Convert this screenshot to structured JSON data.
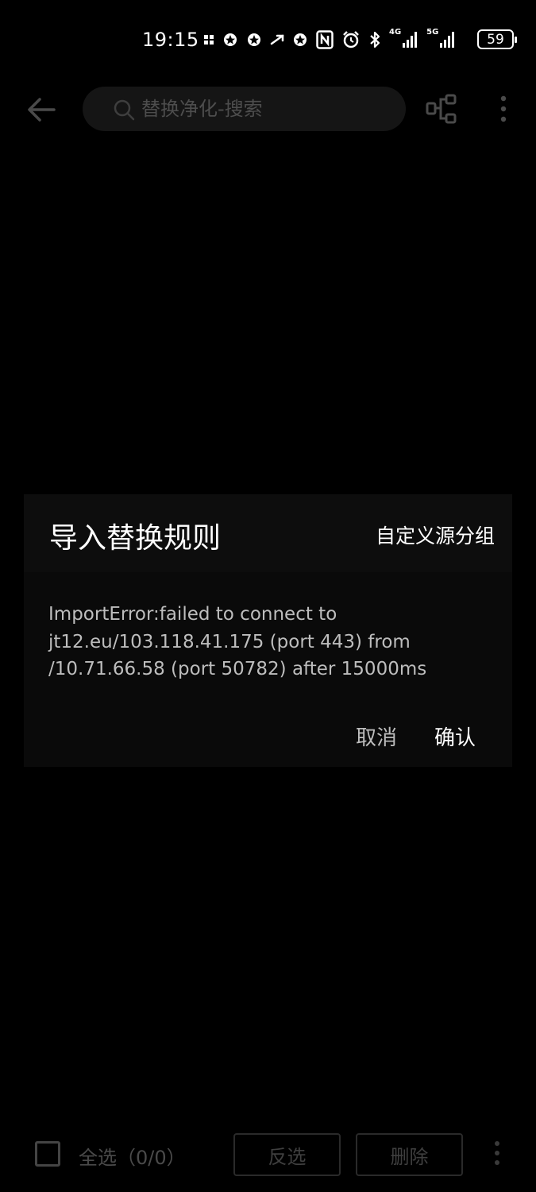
{
  "status_bar": {
    "time": "19:15",
    "signal_4g_label": "4G",
    "signal_5g_label": "5G",
    "battery_level": "59"
  },
  "app_bar": {
    "search_placeholder": "替换净化-搜索"
  },
  "dialog": {
    "title": "导入替换规则",
    "action_label": "自定义源分组",
    "message": "ImportError:failed to connect to jt12.eu/103.118.41.175 (port 443) from /10.71.66.58 (port 50782) after 15000ms",
    "cancel_label": "取消",
    "confirm_label": "确认"
  },
  "bottom_bar": {
    "select_all_label": "全选（0/0）",
    "invert_label": "反选",
    "delete_label": "删除"
  },
  "colors": {
    "background": "#000000",
    "dialog_bg": "#0a0a0a",
    "primary_text": "#ffffff",
    "secondary_text": "#bdbdbd",
    "dimmed_text": "#4a4a4a"
  }
}
